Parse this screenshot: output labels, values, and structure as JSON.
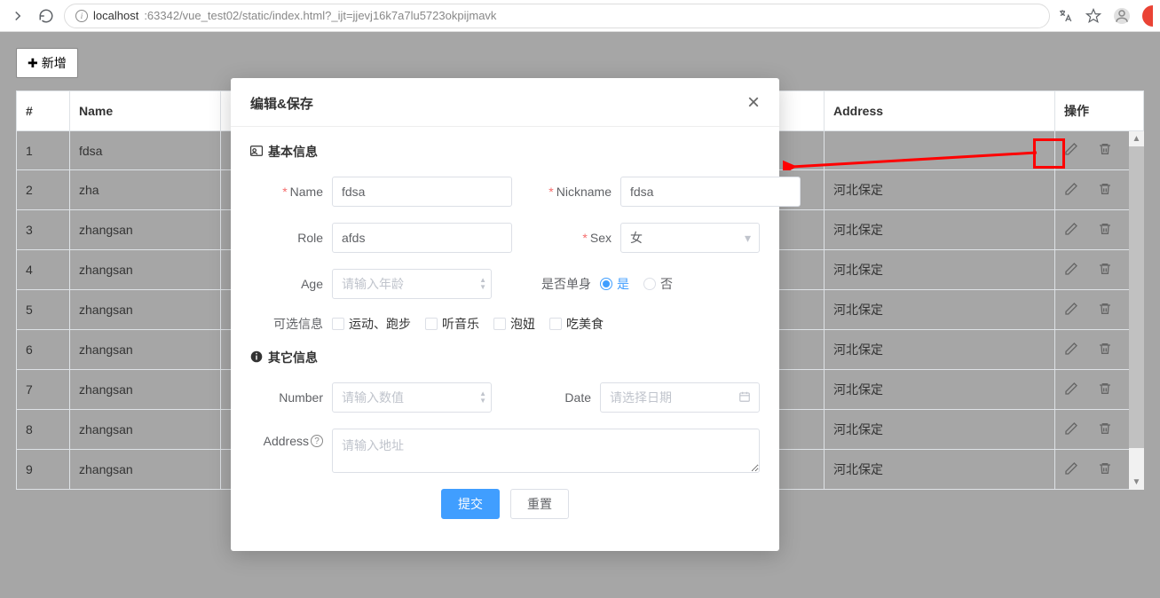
{
  "browser": {
    "url_prefix": "localhost",
    "url_rest": ":63342/vue_test02/static/index.html?_ijt=jjevj16k7a7lu5723okpijmavk"
  },
  "toolbar": {
    "add_label": "新增"
  },
  "table": {
    "headers": {
      "idx": "#",
      "name": "Name",
      "address": "Address",
      "actions": "操作"
    },
    "rows": [
      {
        "idx": "1",
        "name": "fdsa",
        "address": ""
      },
      {
        "idx": "2",
        "name": "zha",
        "address": "河北保定"
      },
      {
        "idx": "3",
        "name": "zhangsan",
        "address": "河北保定"
      },
      {
        "idx": "4",
        "name": "zhangsan",
        "address": "河北保定"
      },
      {
        "idx": "5",
        "name": "zhangsan",
        "address": "河北保定"
      },
      {
        "idx": "6",
        "name": "zhangsan",
        "address": "河北保定"
      },
      {
        "idx": "7",
        "name": "zhangsan",
        "address": "河北保定"
      },
      {
        "idx": "8",
        "name": "zhangsan",
        "address": "河北保定"
      },
      {
        "idx": "9",
        "name": "zhangsan",
        "address": "河北保定"
      }
    ]
  },
  "modal": {
    "title": "编辑&保存",
    "section1": "基本信息",
    "section2": "其它信息",
    "labels": {
      "name": "Name",
      "nickname": "Nickname",
      "role": "Role",
      "sex": "Sex",
      "age": "Age",
      "single": "是否单身",
      "optional": "可选信息",
      "number": "Number",
      "date": "Date",
      "address": "Address"
    },
    "values": {
      "name": "fdsa",
      "nickname": "fdsa",
      "role": "afds",
      "sex": "女",
      "age": "",
      "number": "",
      "date": "",
      "address": ""
    },
    "placeholders": {
      "age": "请输入年龄",
      "number": "请输入数值",
      "date": "请选择日期",
      "address": "请输入地址"
    },
    "radio": {
      "yes": "是",
      "no": "否",
      "checked": "yes"
    },
    "checkboxes": [
      "运动、跑步",
      "听音乐",
      "泡妞",
      "吃美食"
    ],
    "buttons": {
      "submit": "提交",
      "reset": "重置"
    }
  }
}
